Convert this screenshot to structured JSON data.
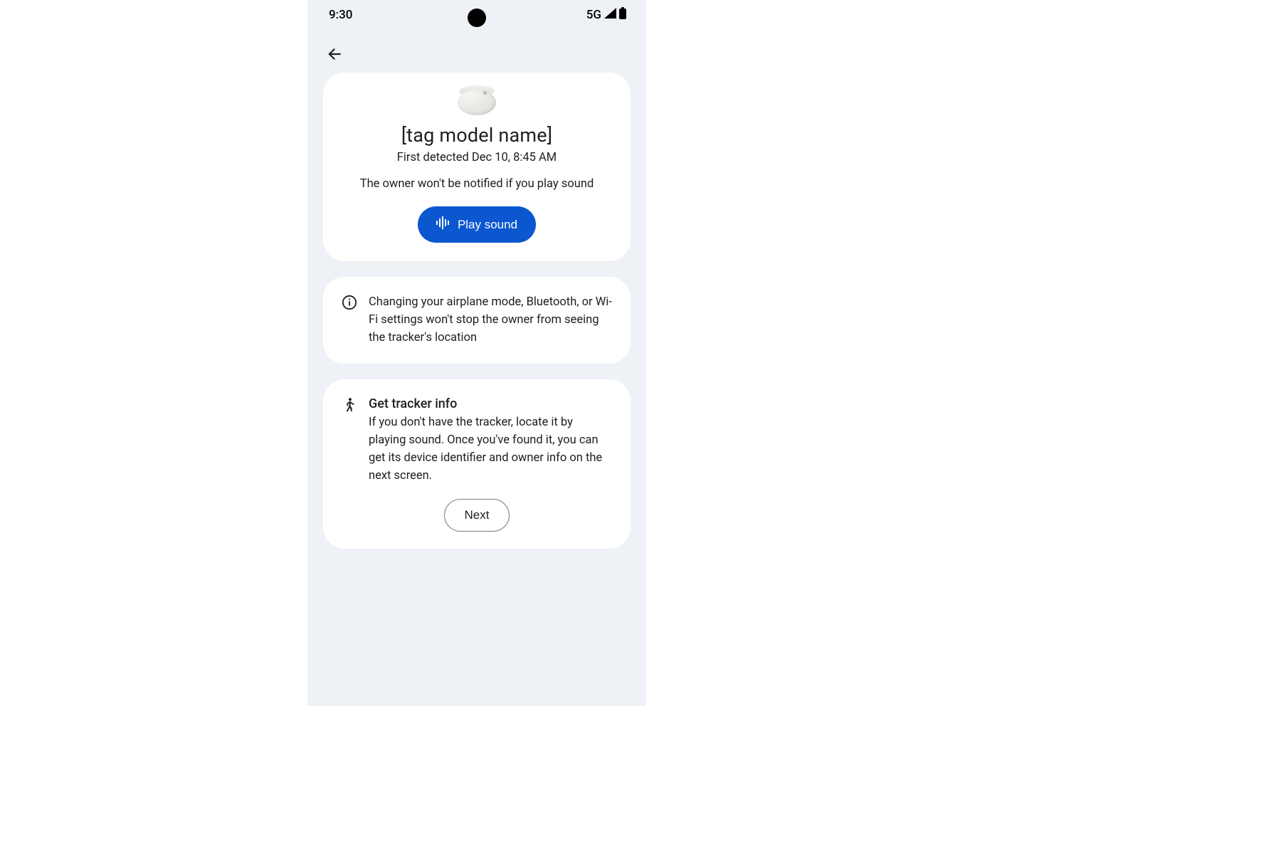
{
  "status_bar": {
    "time": "9:30",
    "network": "5G"
  },
  "main_card": {
    "title": "[tag model name]",
    "detected": "First detected Dec 10, 8:45 AM",
    "notice": "The owner won't be notified if you play sound",
    "play_button": "Play sound"
  },
  "info_card": {
    "text": "Changing your airplane mode, Bluetooth, or Wi-Fi settings won't stop the owner from seeing the tracker's location"
  },
  "action_card": {
    "title": "Get tracker info",
    "body": "If you don't have the tracker, locate it by playing sound. Once you've found it, you can get its device identifier and owner info on the next screen.",
    "next_button": "Next"
  }
}
